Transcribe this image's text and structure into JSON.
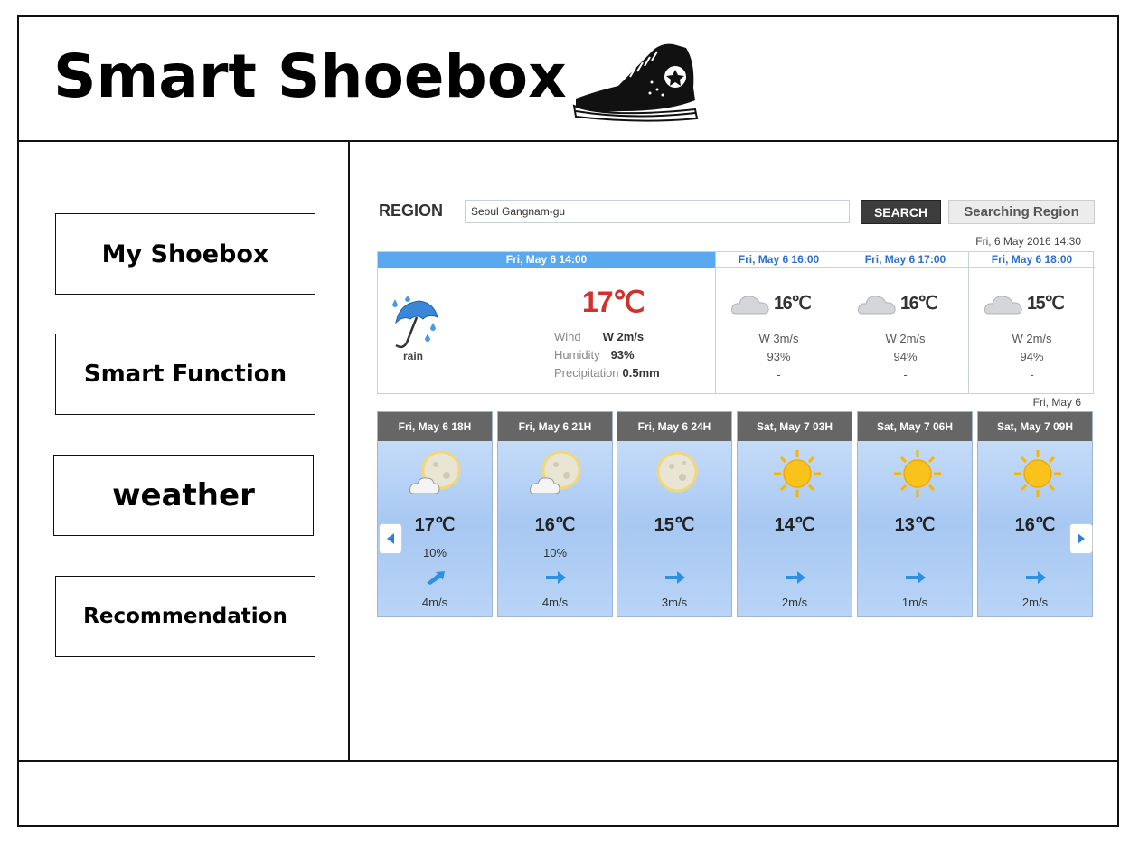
{
  "header": {
    "title": "Smart Shoebox",
    "logo_icon": "sneaker-icon"
  },
  "sidebar": {
    "items": [
      {
        "label": "My Shoebox"
      },
      {
        "label": "Smart Function"
      },
      {
        "label": "weather"
      },
      {
        "label": "Recommendation"
      }
    ]
  },
  "weather": {
    "region_label": "REGION",
    "region_value": "Seoul Gangnam-gu",
    "search_label": "SEARCH",
    "searching_region_label": "Searching Region",
    "timestamp": "Fri, 6 May 2016 14:30",
    "current": {
      "header": "Fri, May 6 14:00",
      "condition": "rain",
      "condition_icon": "umbrella-rain-icon",
      "temp": "17℃",
      "wind_label": "Wind",
      "wind": "W 2m/s",
      "humidity_label": "Humidity",
      "humidity": "93%",
      "precip_label": "Precipitation",
      "precip": "0.5mm"
    },
    "forecast": [
      {
        "header": "Fri, May 6 16:00",
        "temp": "16℃",
        "wind": "W 3m/s",
        "humidity": "93%",
        "precip": "-",
        "icon": "cloud-icon"
      },
      {
        "header": "Fri, May 6 17:00",
        "temp": "16℃",
        "wind": "W 2m/s",
        "humidity": "94%",
        "precip": "-",
        "icon": "cloud-icon"
      },
      {
        "header": "Fri, May 6 18:00",
        "temp": "15℃",
        "wind": "W 2m/s",
        "humidity": "94%",
        "precip": "-",
        "icon": "cloud-icon"
      }
    ],
    "hourly_date": "Fri, May 6",
    "hourly": [
      {
        "header": "Fri, May 6 18H",
        "temp": "17℃",
        "pop": "10%",
        "wind": "4m/s",
        "icon": "moon-cloud-icon"
      },
      {
        "header": "Fri, May 6 21H",
        "temp": "16℃",
        "pop": "10%",
        "wind": "4m/s",
        "icon": "moon-cloud-icon"
      },
      {
        "header": "Fri, May 6 24H",
        "temp": "15℃",
        "pop": "",
        "wind": "3m/s",
        "icon": "moon-icon"
      },
      {
        "header": "Sat, May 7 03H",
        "temp": "14℃",
        "pop": "",
        "wind": "2m/s",
        "icon": "sun-icon"
      },
      {
        "header": "Sat, May 7 06H",
        "temp": "13℃",
        "pop": "",
        "wind": "1m/s",
        "icon": "sun-icon"
      },
      {
        "header": "Sat, May 7 09H",
        "temp": "16℃",
        "pop": "",
        "wind": "2m/s",
        "icon": "sun-icon"
      }
    ],
    "colors": {
      "header_blue": "#5aa9f0",
      "temp_red": "#d0312d",
      "search_btn": "#3c3c3c"
    }
  }
}
